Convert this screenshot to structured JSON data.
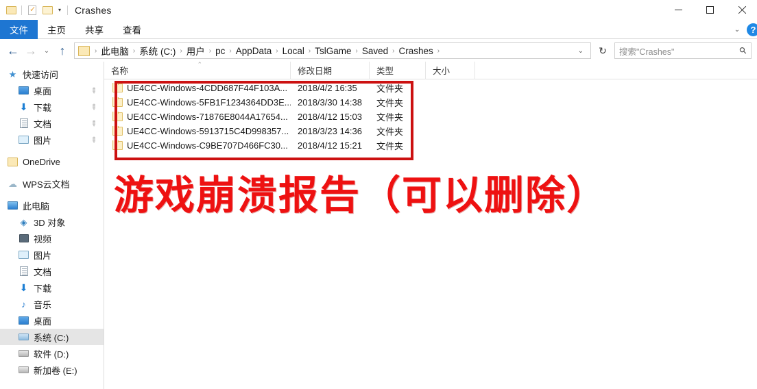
{
  "window": {
    "title": "Crashes",
    "quick_access": [
      {
        "name": "quick-access-folder-icon",
        "glyph": "folder"
      },
      {
        "name": "quick-access-properties-icon",
        "glyph": "doc-check"
      },
      {
        "name": "quick-access-new-folder-icon",
        "glyph": "folder-plain"
      }
    ],
    "customize_caret": "▾",
    "controls": {
      "minimize": "—",
      "maximize": "▢",
      "close": "✕"
    }
  },
  "ribbon": {
    "tabs": [
      {
        "label": "文件",
        "active": true
      },
      {
        "label": "主页",
        "active": false
      },
      {
        "label": "共享",
        "active": false
      },
      {
        "label": "查看",
        "active": false
      }
    ],
    "collapse_caret": "⌄",
    "help_label": "?"
  },
  "addressbar": {
    "back": "←",
    "forward": "→",
    "recent": "⌄",
    "up": "↑",
    "breadcrumbs": [
      "此电脑",
      "系统 (C:)",
      "用户",
      "pc",
      "AppData",
      "Local",
      "TslGame",
      "Saved",
      "Crashes"
    ],
    "separator": "›",
    "dropdown": "⌄",
    "refresh": "↻",
    "search": {
      "placeholder": "搜索\"Crashes\"",
      "icon": "⚲"
    }
  },
  "sidebar": {
    "items": [
      {
        "label": "快速访问",
        "icon": "star-icon",
        "indent": false,
        "pinned": false,
        "selected": false
      },
      {
        "label": "桌面",
        "icon": "desktop-icon",
        "indent": true,
        "pinned": true,
        "selected": false
      },
      {
        "label": "下载",
        "icon": "download-icon",
        "indent": true,
        "pinned": true,
        "selected": false
      },
      {
        "label": "文档",
        "icon": "documents-icon",
        "indent": true,
        "pinned": true,
        "selected": false
      },
      {
        "label": "图片",
        "icon": "pictures-icon",
        "indent": true,
        "pinned": true,
        "selected": false
      },
      {
        "label": "OneDrive",
        "icon": "onedrive-icon",
        "indent": false,
        "pinned": false,
        "selected": false
      },
      {
        "label": "WPS云文档",
        "icon": "cloud-icon",
        "indent": false,
        "pinned": false,
        "selected": false
      },
      {
        "label": "此电脑",
        "icon": "this-pc-icon",
        "indent": false,
        "pinned": false,
        "selected": false
      },
      {
        "label": "3D 对象",
        "icon": "3d-objects-icon",
        "indent": true,
        "pinned": false,
        "selected": false
      },
      {
        "label": "视频",
        "icon": "videos-icon",
        "indent": true,
        "pinned": false,
        "selected": false
      },
      {
        "label": "图片",
        "icon": "pictures-icon",
        "indent": true,
        "pinned": false,
        "selected": false
      },
      {
        "label": "文档",
        "icon": "documents-icon",
        "indent": true,
        "pinned": false,
        "selected": false
      },
      {
        "label": "下载",
        "icon": "download-icon",
        "indent": true,
        "pinned": false,
        "selected": false
      },
      {
        "label": "音乐",
        "icon": "music-icon",
        "indent": true,
        "pinned": false,
        "selected": false
      },
      {
        "label": "桌面",
        "icon": "desktop-icon",
        "indent": true,
        "pinned": false,
        "selected": false
      },
      {
        "label": "系统 (C:)",
        "icon": "system-drive-icon",
        "indent": true,
        "pinned": false,
        "selected": true
      },
      {
        "label": "软件 (D:)",
        "icon": "drive-icon",
        "indent": true,
        "pinned": false,
        "selected": false
      },
      {
        "label": "新加卷 (E:)",
        "icon": "drive-icon",
        "indent": true,
        "pinned": false,
        "selected": false
      }
    ],
    "pin_glyph": "📌"
  },
  "filelist": {
    "columns": [
      {
        "label": "名称",
        "key": "name"
      },
      {
        "label": "修改日期",
        "key": "date"
      },
      {
        "label": "类型",
        "key": "type"
      },
      {
        "label": "大小",
        "key": "size"
      }
    ],
    "sort_indicator": "⌃",
    "rows": [
      {
        "name": "UE4CC-Windows-4CDD687F44F103A...",
        "date": "2018/4/2 16:35",
        "type": "文件夹",
        "size": ""
      },
      {
        "name": "UE4CC-Windows-5FB1F1234364DD3E...",
        "date": "2018/3/30 14:38",
        "type": "文件夹",
        "size": ""
      },
      {
        "name": "UE4CC-Windows-71876E8044A17654...",
        "date": "2018/4/12 15:03",
        "type": "文件夹",
        "size": ""
      },
      {
        "name": "UE4CC-Windows-5913715C4D998357...",
        "date": "2018/3/23 14:36",
        "type": "文件夹",
        "size": ""
      },
      {
        "name": "UE4CC-Windows-C9BE707D466FC30...",
        "date": "2018/4/12 15:21",
        "type": "文件夹",
        "size": ""
      }
    ]
  },
  "annotations": {
    "note_text": "游戏崩溃报告（可以删除）",
    "color": "#ee1111",
    "box_color": "#cc1111"
  }
}
